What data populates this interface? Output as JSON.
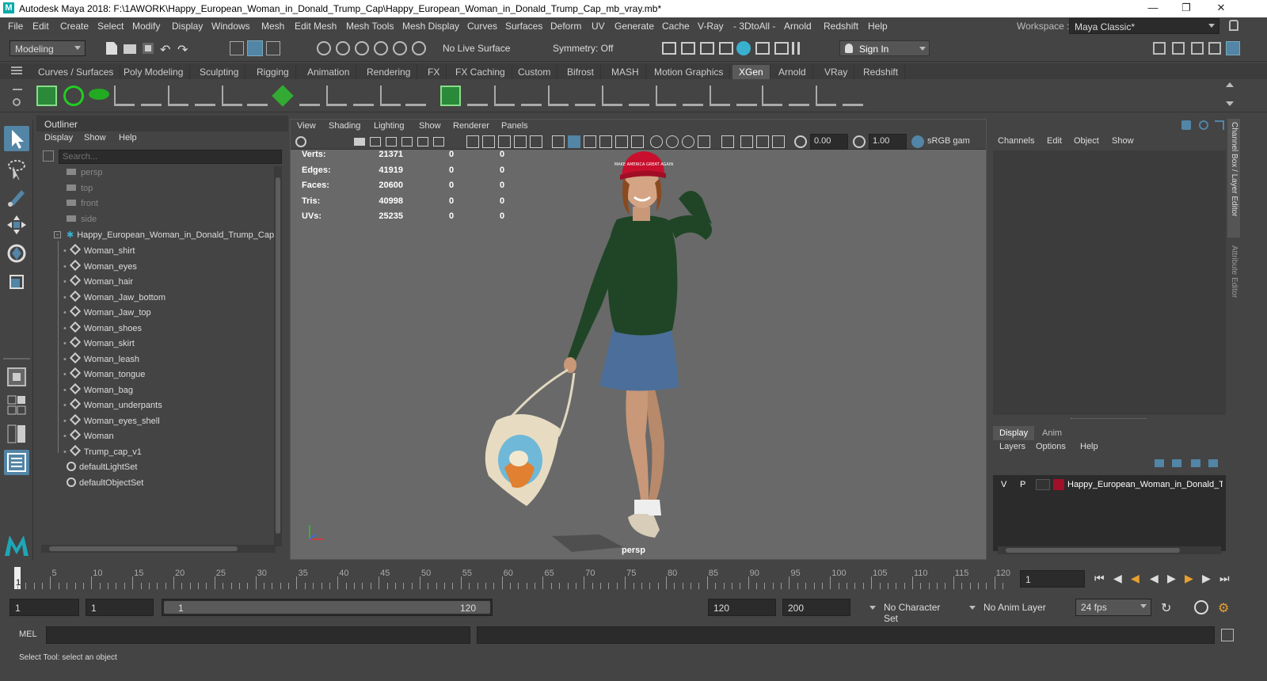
{
  "window": {
    "title": "Autodesk Maya 2018: F:\\1AWORK\\Happy_European_Woman_in_Donald_Trump_Cap\\Happy_European_Woman_in_Donald_Trump_Cap_mb_vray.mb*",
    "logo": "M"
  },
  "menubar": {
    "items": [
      "File",
      "Edit",
      "Create",
      "Select",
      "Modify",
      "Display",
      "Windows",
      "Mesh",
      "Edit Mesh",
      "Mesh Tools",
      "Mesh Display",
      "Curves",
      "Surfaces",
      "Deform",
      "UV",
      "Generate",
      "Cache",
      "V-Ray",
      "- 3DtoAll -",
      "Arnold",
      "Redshift",
      "Help"
    ],
    "workspace_label": "Workspace :",
    "workspace_value": "Maya Classic*"
  },
  "statusline": {
    "mode": "Modeling",
    "live_surface": "No Live Surface",
    "symmetry": "Symmetry: Off",
    "sign_in": "Sign In"
  },
  "shelf": {
    "tabs": [
      "Curves / Surfaces",
      "Poly Modeling",
      "Sculpting",
      "Rigging",
      "Animation",
      "Rendering",
      "FX",
      "FX Caching",
      "Custom",
      "Bifrost",
      "MASH",
      "Motion Graphics",
      "XGen",
      "Arnold",
      "VRay",
      "Redshift"
    ],
    "active_tab": "XGen"
  },
  "outliner": {
    "title": "Outliner",
    "menu": [
      "Display",
      "Show",
      "Help"
    ],
    "search_placeholder": "Search...",
    "cameras": [
      "persp",
      "top",
      "front",
      "side"
    ],
    "root": "Happy_European_Woman_in_Donald_Trump_Cap",
    "children": [
      "Woman_shirt",
      "Woman_eyes",
      "Woman_hair",
      "Woman_Jaw_bottom",
      "Woman_Jaw_top",
      "Woman_shoes",
      "Woman_skirt",
      "Woman_leash",
      "Woman_tongue",
      "Woman_bag",
      "Woman_underpants",
      "Woman_eyes_shell",
      "Woman",
      "Trump_cap_v1"
    ],
    "sets": [
      "defaultLightSet",
      "defaultObjectSet"
    ]
  },
  "viewport": {
    "menu": [
      "View",
      "Shading",
      "Lighting",
      "Show",
      "Renderer",
      "Panels"
    ],
    "exposure": "0.00",
    "gamma": "1.00",
    "colorspace": "sRGB gam",
    "camera_label": "persp",
    "cap_text": "MAKE AMERICA GREAT AGAIN",
    "hud": [
      {
        "label": "Verts:",
        "a": "21371",
        "b": "0",
        "c": "0"
      },
      {
        "label": "Edges:",
        "a": "41919",
        "b": "0",
        "c": "0"
      },
      {
        "label": "Faces:",
        "a": "20600",
        "b": "0",
        "c": "0"
      },
      {
        "label": "Tris:",
        "a": "40998",
        "b": "0",
        "c": "0"
      },
      {
        "label": "UVs:",
        "a": "25235",
        "b": "0",
        "c": "0"
      }
    ]
  },
  "channelbox": {
    "menu": [
      "Channels",
      "Edit",
      "Object",
      "Show"
    ],
    "side_tabs": [
      "Channel Box / Layer Editor",
      "Attribute Editor"
    ],
    "layer_tabs": [
      "Display",
      "Anim"
    ],
    "layer_menu": [
      "Layers",
      "Options",
      "Help"
    ],
    "layer": {
      "v": "V",
      "p": "P",
      "name": "Happy_European_Woman_in_Donald_T",
      "color": "#a0102a"
    }
  },
  "timeline": {
    "ticks": [
      "5",
      "10",
      "15",
      "20",
      "25",
      "30",
      "35",
      "40",
      "45",
      "50",
      "55",
      "60",
      "65",
      "70",
      "75",
      "80",
      "85",
      "90",
      "95",
      "100",
      "105",
      "110",
      "115",
      "120"
    ],
    "start_tick": "1",
    "current_frame": "1"
  },
  "range": {
    "start": "1",
    "playback_start": "1",
    "slider_start": "1",
    "slider_end": "120",
    "playback_end": "120",
    "end": "200",
    "character_set": "No Character Set",
    "anim_layer": "No Anim Layer",
    "fps": "24 fps"
  },
  "cmdline": {
    "label": "MEL"
  },
  "helpline": {
    "text": "Select Tool: select an object"
  }
}
